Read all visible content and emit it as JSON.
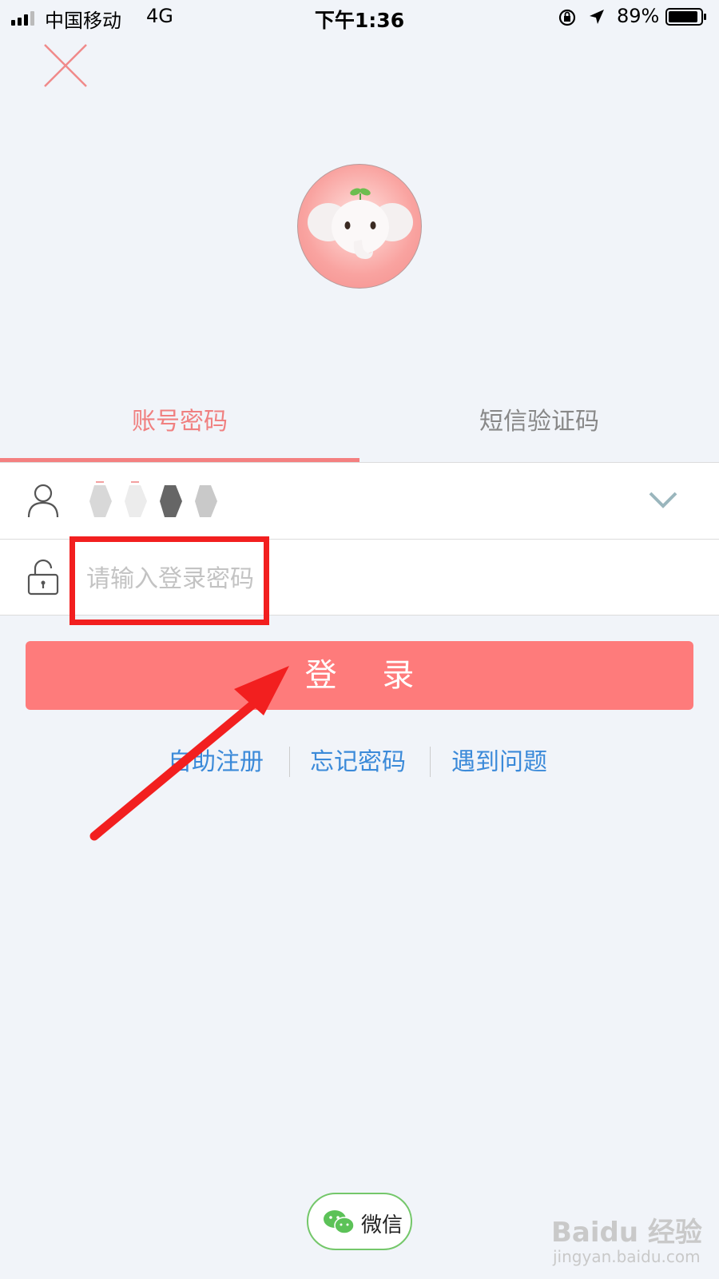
{
  "status_bar": {
    "carrier": "中国移动",
    "network": "4G",
    "time": "下午1:36",
    "battery_percent": "89%"
  },
  "icons": {
    "close": "close-icon",
    "avatar": "elephant-avatar",
    "user": "user-icon",
    "lock": "lock-icon",
    "dropdown": "chevron-down-icon",
    "wechat": "wechat-icon"
  },
  "tabs": [
    {
      "label": "账号密码",
      "active": true
    },
    {
      "label": "短信验证码",
      "active": false
    }
  ],
  "form": {
    "password_placeholder": "请输入登录密码"
  },
  "login_button": "登 录",
  "links": {
    "register": "自助注册",
    "forgot": "忘记密码",
    "problem": "遇到问题"
  },
  "wechat_label": "微信",
  "watermark": {
    "brand": "Baidu 经验",
    "url": "jingyan.baidu.com"
  },
  "colors": {
    "accent": "#fe7b7b",
    "active_tab": "#f08080",
    "link": "#3b8ad9",
    "annotation": "#f21f1f",
    "wechat_green": "#74c76a"
  }
}
